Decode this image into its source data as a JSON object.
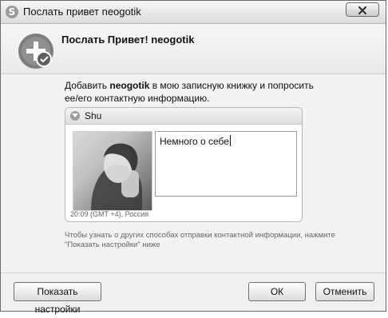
{
  "window": {
    "title": "Послать привет neogotik"
  },
  "header": {
    "title": "Послать Привет! neogotik"
  },
  "description": {
    "prefix": "Добавить ",
    "name": "neogotik",
    "suffix": " в мою записную книжку и попросить ее/его контактную информацию."
  },
  "card": {
    "contact_name": "Shu",
    "about_text": "Немного о себе",
    "meta": "20:09 (GMT +4), Россия"
  },
  "hint": "Чтобы узнать о других способах отправки контактной информации, нажмите \"Показать настройки\" ниже",
  "buttons": {
    "show_settings": "Показать настройки",
    "ok": "ОК",
    "cancel": "Отменить"
  }
}
